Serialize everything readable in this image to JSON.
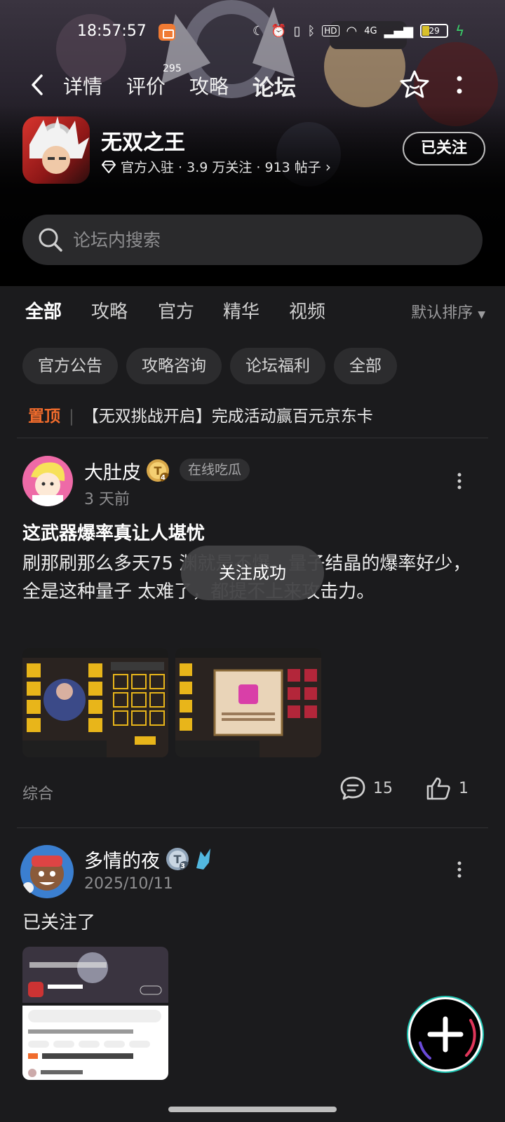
{
  "status_bar": {
    "time": "18:57:57",
    "network": "4G",
    "battery": "29"
  },
  "nav": {
    "tabs": [
      {
        "label": "详情"
      },
      {
        "label": "评价",
        "badge": "295"
      },
      {
        "label": "攻略"
      },
      {
        "label": "论坛",
        "active": true
      }
    ]
  },
  "game": {
    "name": "无双之王",
    "meta": "官方入驻 · 3.9 万关注 · 913 帖子",
    "follow_label": "已关注"
  },
  "search": {
    "placeholder": "论坛内搜索"
  },
  "categories": {
    "tabs": [
      "全部",
      "攻略",
      "官方",
      "精华",
      "视频"
    ],
    "active": "全部",
    "sort_label": "默认排序"
  },
  "chips": [
    "官方公告",
    "攻略咨询",
    "论坛福利",
    "全部"
  ],
  "pinned": {
    "tag": "置顶",
    "text": "【无双挑战开启】完成活动赢百元京东卡"
  },
  "posts": [
    {
      "author": "大肚皮",
      "level": "4",
      "tag": "在线吃瓜",
      "time": "3 天前",
      "title": "这武器爆率真让人堪忧",
      "body": "刷那刷那么多天75        渊就是不爆。量子结晶的爆率好少，全是这种量子 太难了，都提不上来攻击力。",
      "category": "综合",
      "comments": "15",
      "likes": "1"
    },
    {
      "author": "多情的夜",
      "level": "3",
      "time": "2025/10/11",
      "body": "已关注了"
    }
  ],
  "toast": "关注成功",
  "colors": {
    "accent": "#1fc2b0",
    "pin": "#f06b2c",
    "background": "#1b1b1d"
  }
}
